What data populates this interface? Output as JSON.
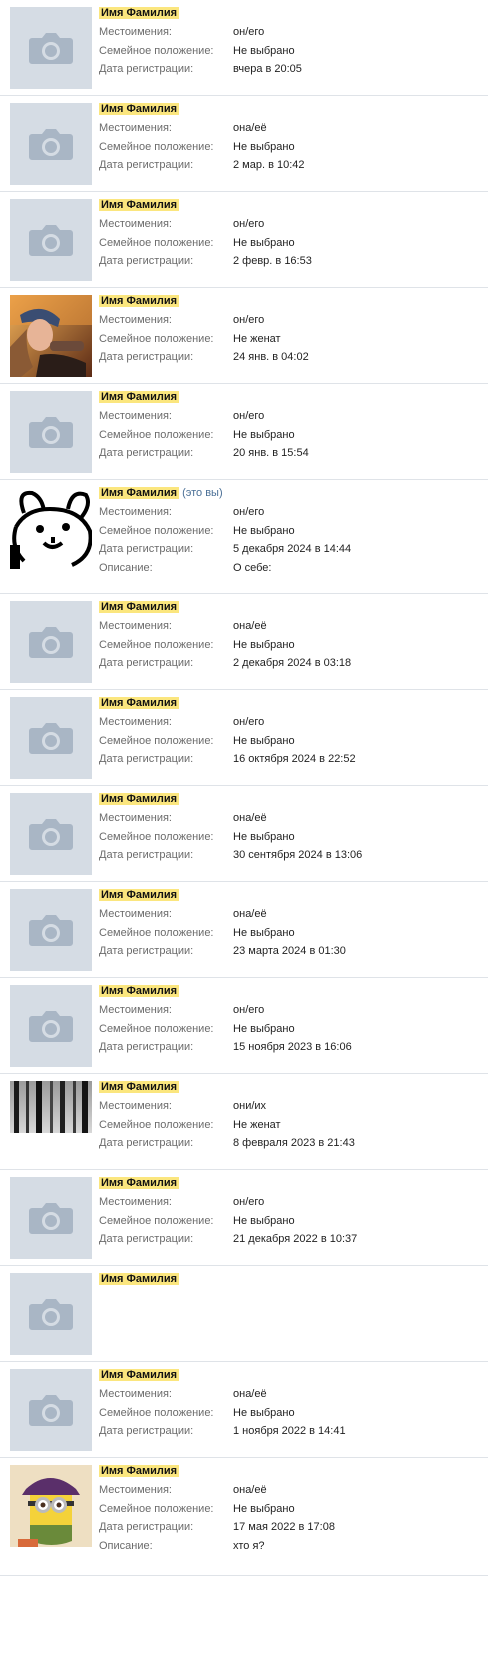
{
  "labels": {
    "pronouns": "Местоимения:",
    "status": "Семейное положение:",
    "registered": "Дата регистрации:",
    "description": "Описание:",
    "you": "(это вы)"
  },
  "users": [
    {
      "name": "Имя Фамилия",
      "avatar": "camera-placeholder",
      "pronouns": "он/его",
      "status": "Не выбрано",
      "registered": "вчера в 20:05"
    },
    {
      "name": "Имя Фамилия",
      "avatar": "camera-placeholder",
      "pronouns": "она/её",
      "status": "Не выбрано",
      "registered": "2 мар. в 10:42"
    },
    {
      "name": "Имя Фамилия",
      "avatar": "camera-placeholder",
      "pronouns": "он/его",
      "status": "Не выбрано",
      "registered": "2 февр. в 16:53"
    },
    {
      "name": "Имя Фамилия",
      "avatar": "photo-portrait",
      "pronouns": "он/его",
      "status": "Не женат",
      "registered": "24 янв. в 04:02"
    },
    {
      "name": "Имя Фамилия",
      "avatar": "camera-placeholder",
      "pronouns": "он/его",
      "status": "Не выбрано",
      "registered": "20 янв. в 15:54"
    },
    {
      "name": "Имя Фамилия",
      "avatar": "cartoon-dog",
      "is_you": true,
      "pronouns": "он/его",
      "status": "Не выбрано",
      "registered": "5 декабря 2024 в 14:44",
      "description": "О себе:"
    },
    {
      "name": "Имя Фамилия",
      "avatar": "camera-placeholder",
      "pronouns": "она/её",
      "status": "Не выбрано",
      "registered": "2 декабря 2024 в 03:18"
    },
    {
      "name": "Имя Фамилия",
      "avatar": "camera-placeholder",
      "pronouns": "он/его",
      "status": "Не выбрано",
      "registered": "16 октября 2024 в 22:52"
    },
    {
      "name": "Имя Фамилия",
      "avatar": "camera-placeholder",
      "pronouns": "она/её",
      "status": "Не выбрано",
      "registered": "30 сентября 2024 в 13:06"
    },
    {
      "name": "Имя Фамилия",
      "avatar": "camera-placeholder",
      "pronouns": "она/её",
      "status": "Не выбрано",
      "registered": "23 марта 2024 в 01:30"
    },
    {
      "name": "Имя Фамилия",
      "avatar": "camera-placeholder",
      "pronouns": "он/его",
      "status": "Не выбрано",
      "registered": "15 ноября 2023 в 16:06"
    },
    {
      "name": "Имя Фамилия",
      "avatar": "forest-photo",
      "pronouns": "они/их",
      "status": "Не женат",
      "registered": "8 февраля 2023 в 21:43"
    },
    {
      "name": "Имя Фамилия",
      "avatar": "camera-placeholder",
      "pronouns": "он/его",
      "status": "Не выбрано",
      "registered": "21 декабря 2022 в 10:37"
    },
    {
      "name": "Имя Фамилия",
      "avatar": "camera-placeholder"
    },
    {
      "name": "Имя Фамилия",
      "avatar": "camera-placeholder",
      "pronouns": "она/её",
      "status": "Не выбрано",
      "registered": "1 ноября 2022 в 14:41"
    },
    {
      "name": "Имя Фамилия",
      "avatar": "minion-photo",
      "pronouns": "она/её",
      "status": "Не выбрано",
      "registered": "17 мая 2022 в 17:08",
      "description": "хто я?"
    }
  ]
}
